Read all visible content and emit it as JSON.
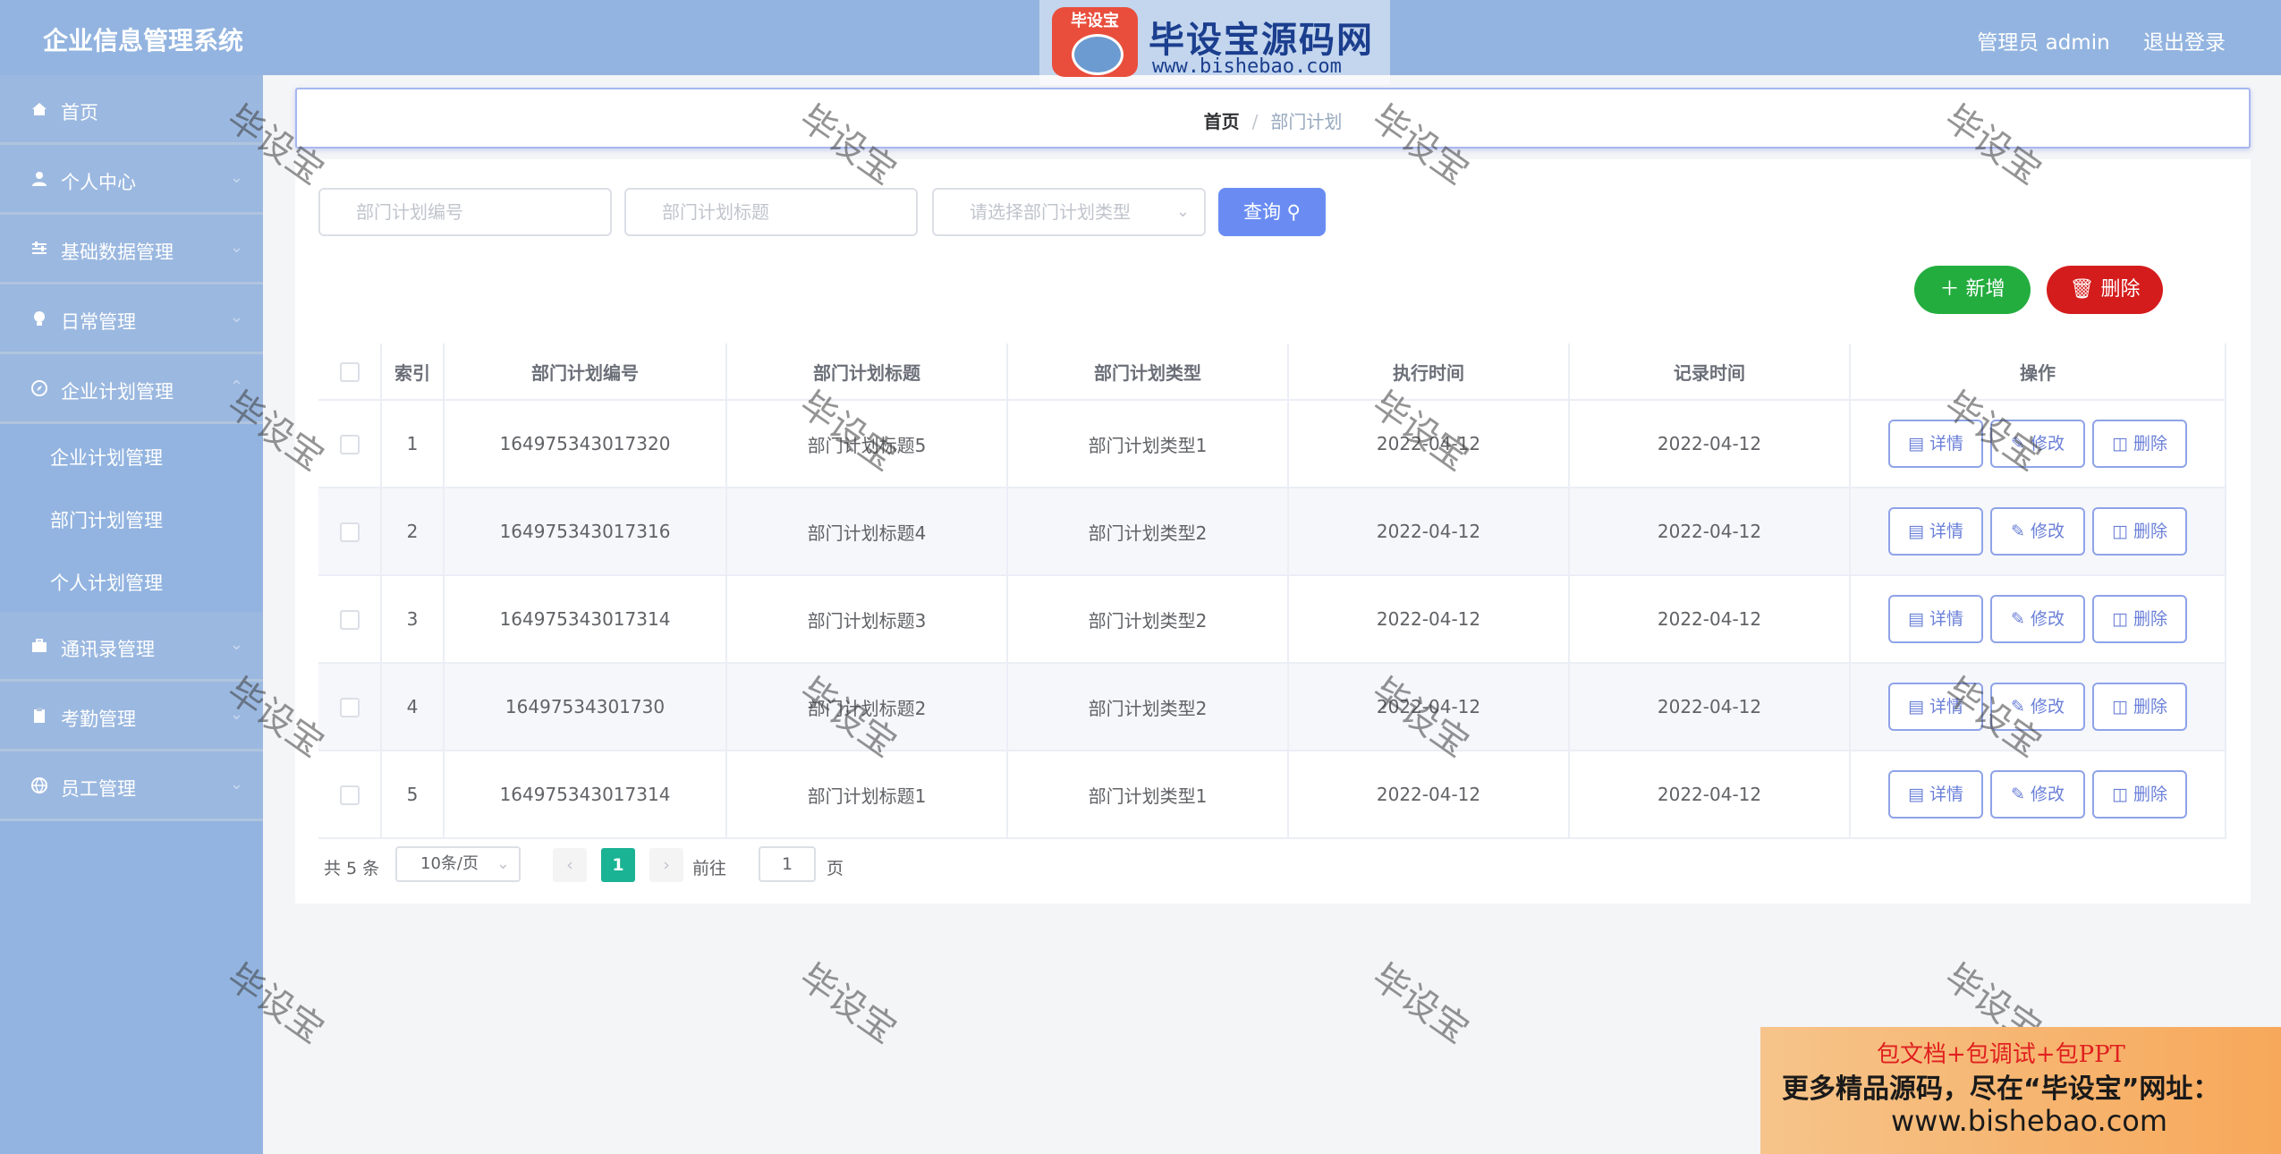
{
  "header": {
    "title": "企业信息管理系统",
    "user": "管理员 admin",
    "logout": "退出登录",
    "logo_badge": "毕设宝",
    "logo_main": "毕设宝源码网",
    "logo_sub": "www.bishebao.com"
  },
  "sidebar": {
    "items": [
      {
        "label": "首页",
        "icon": "home-icon"
      },
      {
        "label": "个人中心",
        "icon": "user-icon"
      },
      {
        "label": "基础数据管理",
        "icon": "sliders-icon"
      },
      {
        "label": "日常管理",
        "icon": "bulb-icon"
      },
      {
        "label": "企业计划管理",
        "icon": "compass-icon"
      },
      {
        "label": "通讯录管理",
        "icon": "briefcase-icon"
      },
      {
        "label": "考勤管理",
        "icon": "clipboard-icon"
      },
      {
        "label": "员工管理",
        "icon": "globe-icon"
      }
    ],
    "submenu": [
      "企业计划管理",
      "部门计划管理",
      "个人计划管理"
    ]
  },
  "breadcrumb": {
    "home": "首页",
    "current": "部门计划"
  },
  "search": {
    "code_placeholder": "部门计划编号",
    "title_placeholder": "部门计划标题",
    "type_placeholder": "请选择部门计划类型",
    "query_label": "查询"
  },
  "actions": {
    "add": "新增",
    "delete": "删除"
  },
  "table": {
    "headers": [
      "索引",
      "部门计划编号",
      "部门计划标题",
      "部门计划类型",
      "执行时间",
      "记录时间",
      "操作"
    ],
    "rows": [
      {
        "index": "1",
        "code": "164975343017320",
        "title": "部门计划标题5",
        "type": "部门计划类型1",
        "exec": "2022-04-12",
        "record": "2022-04-12"
      },
      {
        "index": "2",
        "code": "164975343017316",
        "title": "部门计划标题4",
        "type": "部门计划类型2",
        "exec": "2022-04-12",
        "record": "2022-04-12"
      },
      {
        "index": "3",
        "code": "164975343017314",
        "title": "部门计划标题3",
        "type": "部门计划类型2",
        "exec": "2022-04-12",
        "record": "2022-04-12"
      },
      {
        "index": "4",
        "code": "16497534301730",
        "title": "部门计划标题2",
        "type": "部门计划类型2",
        "exec": "2022-04-12",
        "record": "2022-04-12"
      },
      {
        "index": "5",
        "code": "164975343017314",
        "title": "部门计划标题1",
        "type": "部门计划类型1",
        "exec": "2022-04-12",
        "record": "2022-04-12"
      }
    ],
    "row_actions": {
      "detail": "详情",
      "edit": "修改",
      "delete": "删除"
    }
  },
  "pagination": {
    "total": "共 5 条",
    "page_size": "10条/页",
    "current": "1",
    "goto_label": "前往",
    "goto_value": "1",
    "page_label": "页"
  },
  "watermark": "毕设宝",
  "promo": {
    "line1": "包文档+包调试+包PPT",
    "line2": "更多精品源码，尽在“毕设宝”网址：",
    "line3": "www.bishebao.com"
  },
  "colors": {
    "header_bg": "#93b4e0",
    "primary": "#6a8cf2",
    "add": "#23ad3e",
    "danger": "#d51c1c",
    "page_active": "#1ab394"
  }
}
